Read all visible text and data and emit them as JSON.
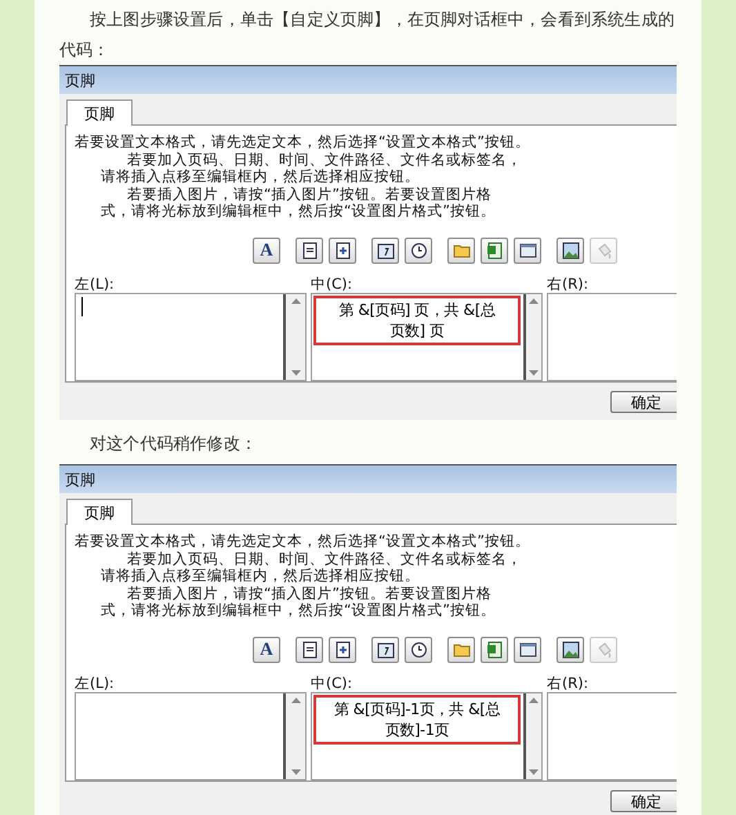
{
  "blocks": [
    {
      "kind": "paragraph",
      "text": "按上图步骤设置后，单击【自定义页脚】，在页脚对话框中，会看到系统生成的代码："
    },
    {
      "kind": "dialog",
      "title": "页脚",
      "tabs": [
        {
          "label": "页脚",
          "selected": true
        }
      ],
      "instructions": [
        {
          "kind": "flush",
          "text": "若要设置文本格式，请先选定文本，然后选择“设置文本格式”按钮。"
        },
        {
          "kind": "indent",
          "text": "若要加入页码、日期、时间、文件路径、文件名或标签名，"
        },
        {
          "kind": "hang",
          "text": "请将插入点移至编辑框内，然后选择相应按钮。"
        },
        {
          "kind": "indent",
          "text": "若要插入图片，请按“插入图片”按钮。若要设置图片格"
        },
        {
          "kind": "hang",
          "text": "式，请将光标放到编辑框中，然后按“设置图片格式”按钮。"
        }
      ],
      "toolbar": [
        {
          "kind": "font",
          "label": "A",
          "disabled": false
        },
        {
          "kind": "page",
          "disabled": false
        },
        {
          "kind": "pages",
          "disabled": false
        },
        {
          "kind": "date",
          "disabled": false
        },
        {
          "kind": "time",
          "disabled": false
        },
        {
          "kind": "folder",
          "disabled": false
        },
        {
          "kind": "file",
          "disabled": false
        },
        {
          "kind": "sheet",
          "disabled": false
        },
        {
          "kind": "picture",
          "disabled": false
        },
        {
          "kind": "format",
          "disabled": true
        }
      ],
      "sections": [
        {
          "label": "左(L):",
          "caret": true
        },
        {
          "label": "中(C):",
          "caret": false,
          "highlighted": true,
          "lines": [
            "第 &[页码] 页，共 &[总",
            "页数] 页"
          ]
        },
        {
          "label": "右(R):",
          "caret": false
        }
      ],
      "ok_button": "确定"
    },
    {
      "kind": "paragraph",
      "text": "对这个代码稍作修改："
    },
    {
      "kind": "dialog",
      "title": "页脚",
      "tabs": [
        {
          "label": "页脚",
          "selected": true
        }
      ],
      "instructions": [
        {
          "kind": "flush",
          "text": "若要设置文本格式，请先选定文本，然后选择“设置文本格式”按钮。"
        },
        {
          "kind": "indent",
          "text": "若要加入页码、日期、时间、文件路径、文件名或标签名，"
        },
        {
          "kind": "hang",
          "text": "请将插入点移至编辑框内，然后选择相应按钮。"
        },
        {
          "kind": "indent",
          "text": "若要插入图片，请按“插入图片”按钮。若要设置图片格"
        },
        {
          "kind": "hang",
          "text": "式，请将光标放到编辑框中，然后按“设置图片格式”按钮。"
        }
      ],
      "toolbar": [
        {
          "kind": "font",
          "label": "A",
          "disabled": false
        },
        {
          "kind": "page",
          "disabled": false
        },
        {
          "kind": "pages",
          "disabled": false
        },
        {
          "kind": "date",
          "disabled": false
        },
        {
          "kind": "time",
          "disabled": false
        },
        {
          "kind": "folder",
          "disabled": false
        },
        {
          "kind": "file",
          "disabled": false
        },
        {
          "kind": "sheet",
          "disabled": false
        },
        {
          "kind": "picture",
          "disabled": false
        },
        {
          "kind": "format",
          "disabled": true
        }
      ],
      "sections": [
        {
          "label": "左(L):",
          "caret": false
        },
        {
          "label": "中(C):",
          "caret": false,
          "highlighted": true,
          "lines": [
            "第 &[页码]-1页，共 &[总",
            "页数]-1页"
          ]
        },
        {
          "label": "右(R):",
          "caret": false
        }
      ],
      "ok_button": "确定"
    }
  ]
}
